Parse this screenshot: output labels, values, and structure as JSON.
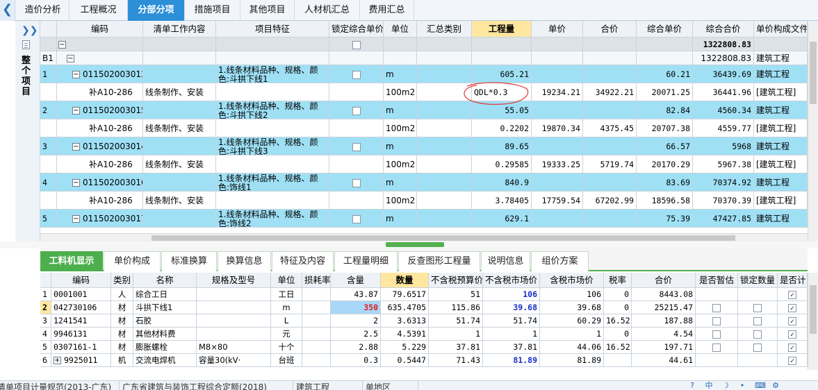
{
  "top_tabs": [
    "造价分析",
    "工程概况",
    "分部分项",
    "措施项目",
    "其他项目",
    "人材机汇总",
    "费用汇总"
  ],
  "active_top_tab": 2,
  "left_rail": {
    "label": "整个项目"
  },
  "upper_grid": {
    "headers": [
      "编码",
      "清单工作内容",
      "项目特征",
      "锁定综合单价",
      "单位",
      "汇总类别",
      "工程量",
      "单价",
      "合价",
      "综合单价",
      "综合合价",
      "单价构成文件"
    ],
    "root_row": {
      "total": "1322808.83"
    },
    "b1_row": {
      "index": "B1",
      "total": "1322808.83",
      "file": "建筑工程"
    },
    "rows": [
      {
        "index": "1",
        "code": "011502003013",
        "feature": "1.线条材料品种、规格、颜色:斗拱下线1",
        "unit": "m",
        "qty": "605.21",
        "comp_price": "60.21",
        "comp_total": "36439.69",
        "file": "建筑工程",
        "sub": {
          "code": "补A10-286",
          "work": "线条制作、安装",
          "unit": "100m2",
          "qty": "QDL*0.3",
          "price": "19234.21",
          "total": "34922.21",
          "comp_price": "20071.25",
          "comp_total": "36441.96",
          "file": "[建筑工程]"
        }
      },
      {
        "index": "2",
        "code": "011502003015",
        "feature": "1.线条材料品种、规格、颜色:斗拱下线2",
        "unit": "m",
        "qty": "55.05",
        "comp_price": "82.84",
        "comp_total": "4560.34",
        "file": "建筑工程",
        "sub": {
          "code": "补A10-286",
          "work": "线条制作、安装",
          "unit": "100m2",
          "qty": "0.2202",
          "price": "19870.34",
          "total": "4375.45",
          "comp_price": "20707.38",
          "comp_total": "4559.77",
          "file": "[建筑工程]"
        }
      },
      {
        "index": "3",
        "code": "011502003014",
        "feature": "1.线条材料品种、规格、颜色:斗拱下线3",
        "unit": "m",
        "qty": "89.65",
        "comp_price": "66.57",
        "comp_total": "5968",
        "file": "建筑工程",
        "sub": {
          "code": "补A10-286",
          "work": "线条制作、安装",
          "unit": "100m2",
          "qty": "0.29585",
          "price": "19333.25",
          "total": "5719.74",
          "comp_price": "20170.29",
          "comp_total": "5967.38",
          "file": "[建筑工程]"
        }
      },
      {
        "index": "4",
        "code": "011502003016",
        "feature": "1.线条材料品种、规格、颜色:饰线1",
        "unit": "m",
        "qty": "840.9",
        "comp_price": "83.69",
        "comp_total": "70374.92",
        "file": "建筑工程",
        "sub": {
          "code": "补A10-286",
          "work": "线条制作、安装",
          "unit": "100m2",
          "qty": "3.78405",
          "price": "17759.54",
          "total": "67202.99",
          "comp_price": "18596.58",
          "comp_total": "70370.39",
          "file": "[建筑工程]"
        }
      },
      {
        "index": "5",
        "code": "011502003017",
        "feature": "1.线条材料品种、规格、颜色:饰线2",
        "unit": "m",
        "qty": "629.1",
        "comp_price": "75.39",
        "comp_total": "47427.85",
        "file": "建筑工程"
      }
    ]
  },
  "bottom_tabs": [
    "工料机显示",
    "单价构成",
    "标准换算",
    "换算信息",
    "特征及内容",
    "工程量明细",
    "反查图形工程量",
    "说明信息",
    "组价方案"
  ],
  "active_bottom_tab": 0,
  "lower_grid": {
    "headers": [
      "编码",
      "类别",
      "名称",
      "规格及型号",
      "单位",
      "损耗率",
      "含量",
      "数量",
      "不含税预算价",
      "不含税市场价",
      "含税市场价",
      "税率",
      "合价",
      "是否暂估",
      "锁定数量",
      "是否计"
    ],
    "rows": [
      {
        "index": "1",
        "code": "0001001",
        "type": "人",
        "name": "综合工日",
        "spec": "",
        "unit": "工日",
        "content": "43.87",
        "qty": "79.6517",
        "budget": "51",
        "market": "106",
        "tax_market": "106",
        "rate": "0",
        "total": "8443.08",
        "est": false,
        "lock": false,
        "calc": true
      },
      {
        "index": "2",
        "code": "042730106",
        "type": "材",
        "name": "斗拱下线1",
        "spec": "",
        "unit": "m",
        "content": "350",
        "qty": "635.4705",
        "budget": "115.86",
        "market": "39.68",
        "tax_market": "39.68",
        "rate": "0",
        "total": "25215.47",
        "est": false,
        "lock": false,
        "calc": true
      },
      {
        "index": "3",
        "code": "1241541",
        "type": "材",
        "name": "石胶",
        "spec": "",
        "unit": "L",
        "content": "2",
        "qty": "3.6313",
        "budget": "51.74",
        "market": "51.74",
        "tax_market": "60.29",
        "rate": "16.52",
        "total": "187.88",
        "est": false,
        "lock": false,
        "calc": true
      },
      {
        "index": "4",
        "code": "9946131",
        "type": "材",
        "name": "其他材料费",
        "spec": "",
        "unit": "元",
        "content": "2.5",
        "qty": "4.5391",
        "budget": "1",
        "market": "1",
        "tax_market": "1",
        "rate": "0",
        "total": "4.54",
        "est": false,
        "lock": false,
        "calc": true
      },
      {
        "index": "5",
        "code": "0307161-1",
        "type": "材",
        "name": "膨胀螺栓",
        "spec": "M8×80",
        "unit": "十个",
        "content": "2.88",
        "qty": "5.229",
        "budget": "37.81",
        "market": "37.81",
        "tax_market": "44.06",
        "rate": "16.52",
        "total": "197.71",
        "est": false,
        "lock": false,
        "calc": true
      },
      {
        "index": "6",
        "code": "9925011",
        "type": "机",
        "name": "交流电焊机",
        "spec": "容量30(kV·",
        "unit": "台班",
        "content": "0.3",
        "qty": "0.5447",
        "budget": "71.43",
        "market": "81.89",
        "tax_market": "81.89",
        "rate": "",
        "total": "44.61",
        "est": false,
        "lock": false,
        "calc": true
      }
    ]
  },
  "status_bar": [
    "清单项目计量规范(2013-广东)",
    "广东省建筑与装饰工程综合定额(2018)",
    "建筑工程",
    "单地区"
  ],
  "status_icons": [
    "help-icon",
    "input-method-icon",
    "moon-icon",
    "punctuation-icon",
    "keyboard-icon",
    "settings-icon"
  ],
  "status_ime": "中",
  "colors": {
    "active_tab": "#2c8fd8",
    "bill_row": "#9fe0f5",
    "bottom_active": "#4cae4c",
    "highlight_header": "#ffe7a0",
    "annotation": "#e03a3a"
  }
}
